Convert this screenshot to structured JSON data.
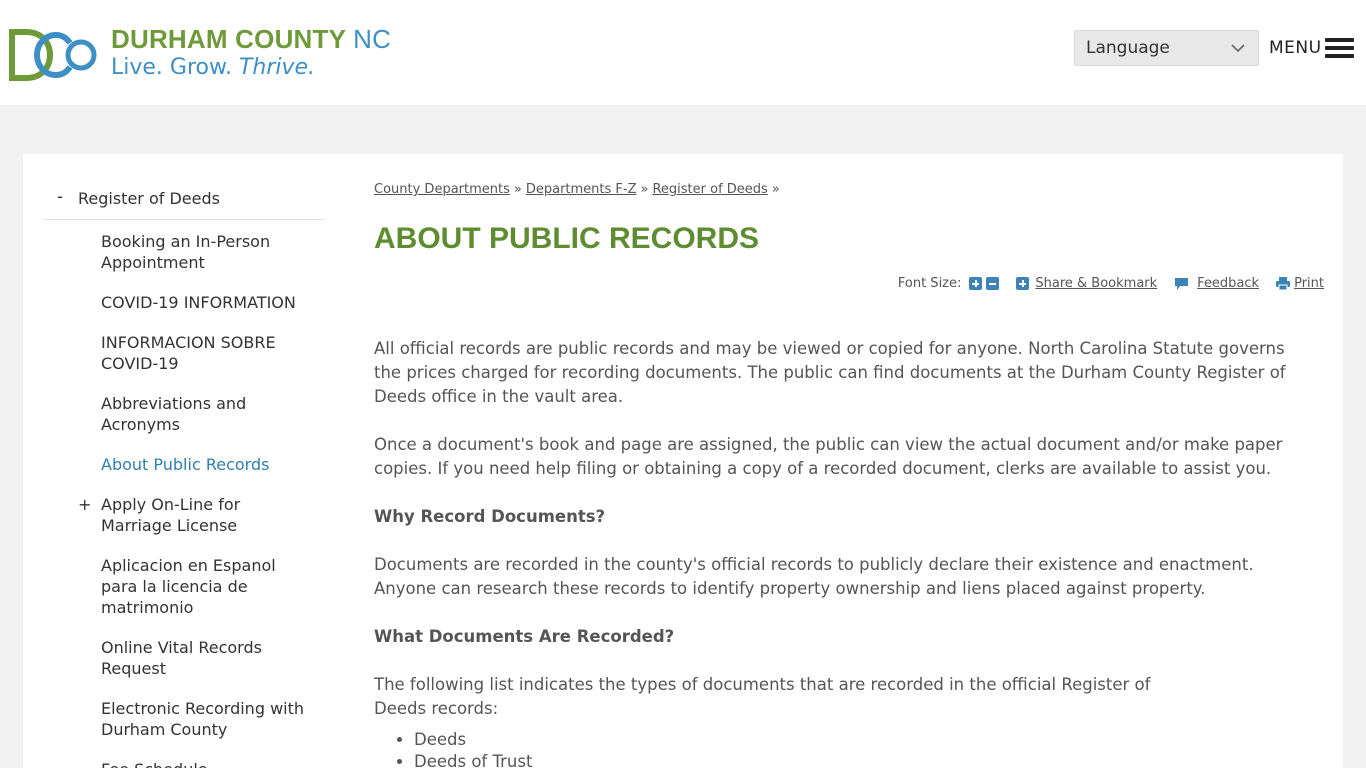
{
  "header": {
    "logo_name": "DURHAM COUNTY",
    "logo_name_suffix": "NC",
    "logo_tagline_plain": "Live. Grow.",
    "logo_tagline_em": "Thrive.",
    "language_label": "Language",
    "menu_label": "MENU"
  },
  "sidebar": {
    "section_title": "Register of Deeds",
    "items": [
      {
        "label": "Booking an In-Person Appointment"
      },
      {
        "label": "COVID-19 INFORMATION"
      },
      {
        "label": "INFORMACION SOBRE COVID-19"
      },
      {
        "label": "Abbreviations and Acronyms"
      },
      {
        "label": "About Public Records"
      },
      {
        "label": "Apply On-Line for Marriage License"
      },
      {
        "label": "Aplicacion en Espanol para la licencia de matrimonio"
      },
      {
        "label": "Online Vital Records Request"
      },
      {
        "label": "Electronic Recording with Durham County"
      },
      {
        "label": "Fee Schedule"
      }
    ]
  },
  "breadcrumb": {
    "items": [
      "County Departments",
      "Departments F-Z",
      "Register of Deeds"
    ],
    "separator": "»"
  },
  "page": {
    "title": "ABOUT PUBLIC RECORDS"
  },
  "tools": {
    "font_size_label": "Font Size:",
    "share_label": "Share & Bookmark",
    "feedback_label": "Feedback",
    "print_label": "Print"
  },
  "content": {
    "p1": "All official records are public records and may be viewed or copied for anyone. North Carolina Statute governs the prices charged for recording documents. The public can find documents at the Durham County Register of Deeds office in the vault area.",
    "p2": "Once a document's book and page are assigned, the public can view the actual document and/or make paper copies. If you need help filing or obtaining a copy of a recorded document, clerks are available to assist you.",
    "h1": "Why Record Documents?",
    "p3": "Documents are recorded in the county's official records to publicly declare their existence and enactment. Anyone can research these records to identify property ownership and liens placed against property.",
    "h2": "What Documents Are Recorded?",
    "p4": "The following list indicates the types of documents that are recorded in the official Register of Deeds records:",
    "list": [
      "Deeds",
      "Deeds of Trust"
    ]
  },
  "colors": {
    "brand_green": "#6f9a3a",
    "brand_blue": "#3d8fc4",
    "title_green": "#5e8c31",
    "active_link": "#2f7fb0"
  }
}
